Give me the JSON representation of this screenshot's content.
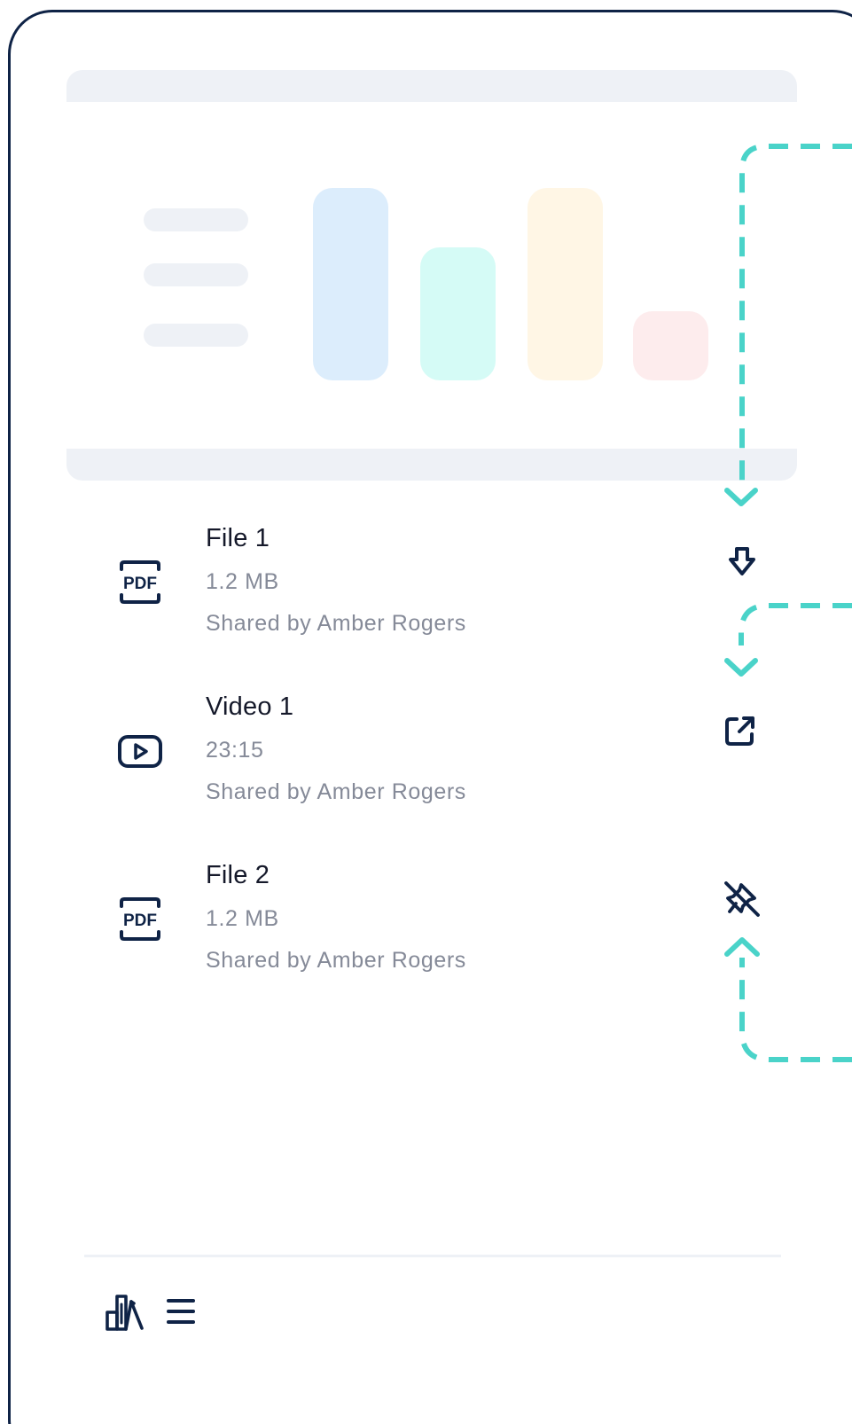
{
  "preview": {
    "legend_lines": 3,
    "bar_levels": [
      1.0,
      0.69,
      1.0,
      0.36
    ],
    "bar_colors": [
      "#dcedfc",
      "#d5fbf6",
      "#fff6e5",
      "#fdeced"
    ],
    "skeleton_color": "#eef1f6"
  },
  "files": [
    {
      "name": "File 1",
      "meta1": "1.2 MB",
      "meta2": "Shared by Amber Rogers",
      "icon": "pdf-icon",
      "action": "download-icon"
    },
    {
      "name": "Video 1",
      "meta1": "23:15",
      "meta2": "Shared by Amber Rogers",
      "icon": "video-play-icon",
      "action": "external-link-icon"
    },
    {
      "name": "File 2",
      "meta1": "1.2 MB",
      "meta2": "Shared by Amber Rogers",
      "icon": "pdf-icon",
      "action": "unpin-icon"
    }
  ],
  "bottom_bar": {
    "left_icon": "library-icon",
    "right_icon": "menu-icon"
  },
  "colors": {
    "frame": "#0f2346",
    "guide": "#4ad3c9",
    "text": "#15192a",
    "muted": "#858a98"
  }
}
